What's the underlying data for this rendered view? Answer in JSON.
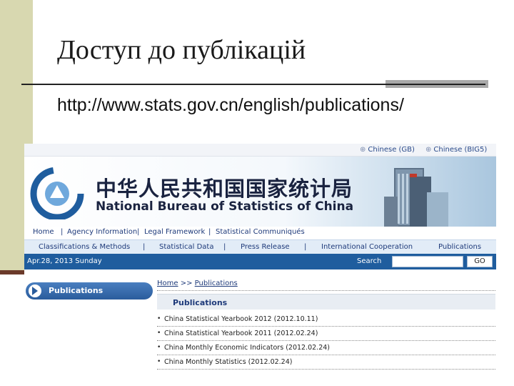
{
  "slide": {
    "title": "Доступ до публікацій",
    "url": "http://www.stats.gov.cn/english/publications/"
  },
  "website": {
    "language_links": [
      "Chinese (GB)",
      "Chinese (BIG5)"
    ],
    "site_title_cn": "中华人民共和国国家统计局",
    "site_title_en": "National Bureau of Statistics of China",
    "nav_primary": [
      "Home",
      "|",
      "Agency Information",
      "|",
      "Legal Framework",
      "|",
      "Statistical Communiqués"
    ],
    "nav_secondary": [
      "Classifications & Methods",
      "|",
      "Statistical Data",
      "|",
      "Press Release",
      "|",
      "International Cooperation",
      "Publications"
    ],
    "date": "Apr.28, 2013 Sunday",
    "search_label": "Search",
    "search_button": "GO",
    "sidebar_label": "Publications",
    "breadcrumb": {
      "home": "Home",
      "sep": ">>",
      "current": "Publications"
    },
    "section_title": "Publications",
    "publications": [
      {
        "title": "China Statistical Yearbook 2012",
        "date": "(2012.10.11)"
      },
      {
        "title": "China Statistical Yearbook 2011",
        "date": "(2012.02.24)"
      },
      {
        "title": "China Monthly Economic Indicators",
        "date": "(2012.02.24)"
      },
      {
        "title": "China Monthly Statistics",
        "date": "(2012.02.24)"
      }
    ]
  },
  "colors": {
    "accent_blue": "#1f5d9e",
    "slide_bar": "#d8d8b0",
    "slide_bar_dark": "#6b3a2a"
  }
}
